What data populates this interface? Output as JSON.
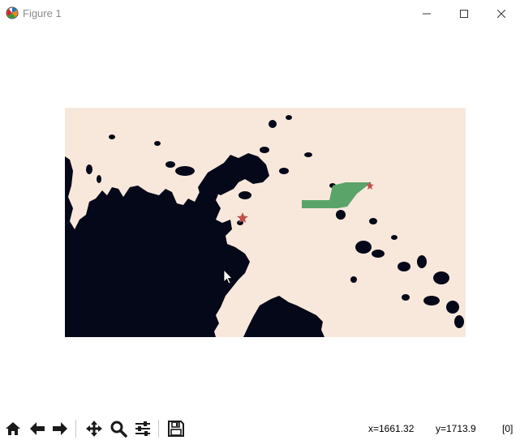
{
  "window": {
    "title": "Figure 1",
    "app_icon": "matplotlib-icon",
    "controls": [
      "minimize-icon",
      "maximize-icon",
      "close-icon"
    ]
  },
  "plot": {
    "land_color": "#f8e8dc",
    "water_color": "#050818",
    "path_color": "#5aa469",
    "marker_color": "#c0504d",
    "markers": [
      "star",
      "star"
    ]
  },
  "toolbar": {
    "tools": [
      {
        "name": "home-icon"
      },
      {
        "name": "back-arrow-icon"
      },
      {
        "name": "forward-arrow-icon"
      },
      {
        "name": "pan-icon"
      },
      {
        "name": "zoom-icon"
      },
      {
        "name": "subplots-configure-icon"
      },
      {
        "name": "save-icon"
      }
    ]
  },
  "status": {
    "x_label": "x=1661.32",
    "y_label": "y=1713.9",
    "value_label": "[0]"
  }
}
